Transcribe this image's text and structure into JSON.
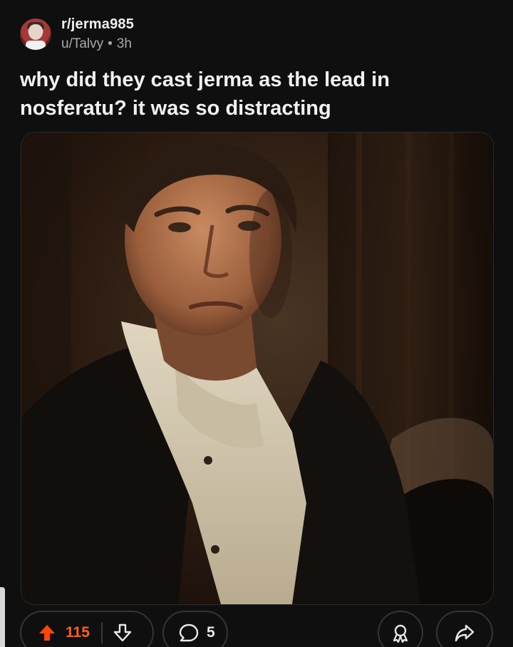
{
  "post": {
    "subreddit": "r/jerma985",
    "author": "u/Talvy",
    "separator": "•",
    "age": "3h",
    "title": "why did they cast jerma as the lead in nosferatu? it was so distracting"
  },
  "actions": {
    "score": "115",
    "comments": "5"
  },
  "icons": {
    "upvote": "upvote-arrow-icon",
    "downvote": "downvote-arrow-icon",
    "comment": "comment-bubble-icon",
    "award": "award-icon",
    "share": "share-icon"
  },
  "colors": {
    "background": "#0f0f0f",
    "upvote_active": "#ff4500",
    "score": "#ff5e1a"
  }
}
